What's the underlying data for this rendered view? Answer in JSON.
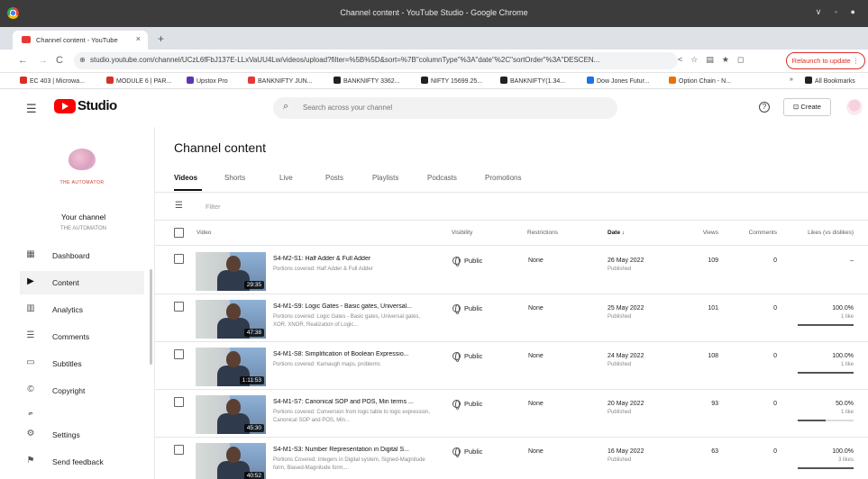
{
  "window": {
    "title": "Channel content - YouTube Studio - Google Chrome",
    "controls": "∨ ◦ ●"
  },
  "tab": {
    "title": "Channel content - YouTube",
    "close": "×",
    "new": "+"
  },
  "address": {
    "url": "studio.youtube.com/channel/UCzL6fFbJ137E-LLxVaUU4Lw/videos/upload?filter=%5B%5D&sort=%7B\"columnType\"%3A\"date\"%2C\"sortOrder\"%3A\"DESCEN...",
    "relaunch": "Relaunch to update  ⋮"
  },
  "bookmarks": [
    {
      "label": "EC 403 | Microwa...",
      "color": "#d93025"
    },
    {
      "label": "MODULE 6 | PAR...",
      "color": "#d93025"
    },
    {
      "label": "Upstox Pro",
      "color": "#5e35b1"
    },
    {
      "label": "BANKNIFTY JUN...",
      "color": "#e53935"
    },
    {
      "label": "BANKNIFTY 3362...",
      "color": "#222"
    },
    {
      "label": "NIFTY 15699.25...",
      "color": "#222"
    },
    {
      "label": "BANKNIFTY(1.34...",
      "color": "#222"
    },
    {
      "label": "Dow Jones Futur...",
      "color": "#1a73e8"
    },
    {
      "label": "Option Chain - N...",
      "color": "#e8710a"
    },
    {
      "label": "»",
      "color": ""
    },
    {
      "label": "All Bookmarks",
      "color": "#222"
    }
  ],
  "header": {
    "logo_text": "Studio",
    "search_placeholder": "Search across your channel",
    "help": "?",
    "create": "Create"
  },
  "sidebar": {
    "brand": "THE AUTOMATOR",
    "your_channel": "Your channel",
    "channel_name": "THE AUTOMATON",
    "items": [
      {
        "label": "Dashboard",
        "icon": "dashboard-icon",
        "glyph": "▦"
      },
      {
        "label": "Content",
        "icon": "content-icon",
        "glyph": "▶"
      },
      {
        "label": "Analytics",
        "icon": "analytics-icon",
        "glyph": "▥"
      },
      {
        "label": "Comments",
        "icon": "comments-icon",
        "glyph": "☰"
      },
      {
        "label": "Subtitles",
        "icon": "subtitles-icon",
        "glyph": "▭"
      },
      {
        "label": "Copyright",
        "icon": "copyright-icon",
        "glyph": "©"
      },
      {
        "label": "Earn",
        "icon": "earn-icon",
        "glyph": "$"
      },
      {
        "label": "Settings",
        "icon": "settings-icon",
        "glyph": "⚙"
      },
      {
        "label": "Send feedback",
        "icon": "feedback-icon",
        "glyph": "⚑"
      }
    ]
  },
  "main": {
    "title": "Channel content",
    "tabs": [
      "Videos",
      "Shorts",
      "Live",
      "Posts",
      "Playlists",
      "Podcasts",
      "Promotions"
    ],
    "filter_placeholder": "Filter",
    "columns": [
      "Video",
      "Visibility",
      "Restrictions",
      "Date ↓",
      "Views",
      "Comments",
      "Likes (vs dislikes)"
    ],
    "rows": [
      {
        "title": "S4-M2-S1: Half Adder & Full Adder",
        "desc": "Portions covered: Half Adder & Full Adder",
        "duration": "29:35",
        "visibility": "Public",
        "restrictions": "None",
        "date": "26 May 2022",
        "status": "Published",
        "views": "109",
        "comments": "0",
        "likes": "–",
        "like_count": "",
        "like_ratio": null
      },
      {
        "title": "S4-M1-S9: Logic Gates - Basic gates, Universal...",
        "desc": "Portions covered: Logic Gates - Basic gates, Universal gates, XOR, XNOR, Realization of Logic...",
        "duration": "47:38",
        "visibility": "Public",
        "restrictions": "None",
        "date": "25 May 2022",
        "status": "Published",
        "views": "101",
        "comments": "0",
        "likes": "100.0%",
        "like_count": "1 like",
        "like_ratio": 1.0
      },
      {
        "title": "S4-M1-S8: Simplification of Boolean Expressio...",
        "desc": "Portions covered: Karnaugh maps, problems",
        "duration": "1:11:53",
        "visibility": "Public",
        "restrictions": "None",
        "date": "24 May 2022",
        "status": "Published",
        "views": "108",
        "comments": "0",
        "likes": "100.0%",
        "like_count": "1 like",
        "like_ratio": 1.0
      },
      {
        "title": "S4-M1-S7: Canonical SOP and POS, Min terms ...",
        "desc": "Portions covered: Conversion from logic table to logic expression, Canonical SOP and POS, Min...",
        "duration": "45:30",
        "visibility": "Public",
        "restrictions": "None",
        "date": "20 May 2022",
        "status": "Published",
        "views": "93",
        "comments": "0",
        "likes": "50.0%",
        "like_count": "1 like",
        "like_ratio": 0.5
      },
      {
        "title": "S4-M1-S3: Number Representation in Digital S...",
        "desc": "Portions Covered: Integers in Digital system, Signed-Magnitude form, Biased-Magnitude form,...",
        "duration": "40:52",
        "visibility": "Public",
        "restrictions": "None",
        "date": "16 May 2022",
        "status": "Published",
        "views": "63",
        "comments": "0",
        "likes": "100.0%",
        "like_count": "3 likes",
        "like_ratio": 1.0
      }
    ]
  }
}
